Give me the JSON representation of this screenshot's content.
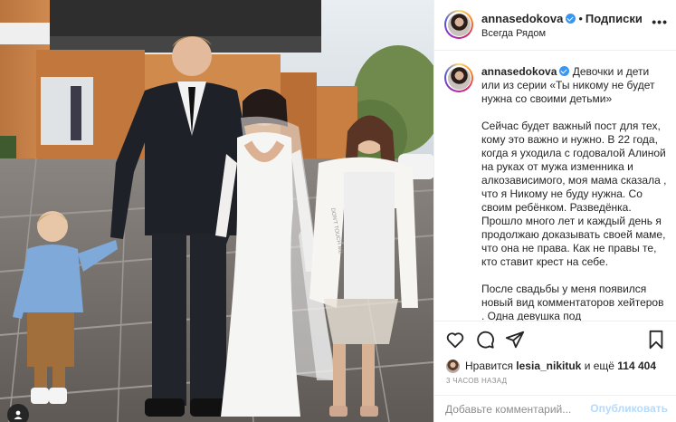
{
  "post": {
    "username": "annasedokova",
    "follow_label": "Подписки",
    "location": "Всегда Рядом"
  },
  "caption": {
    "paragraphs": [
      "Девочки и дети или из серии «Ты никому не будет нужна со своими детьми»",
      "Сейчас будет важный пост для тех, кому это важно и нужно. В 22 года, когда я уходила с годовалой Алиной на руках от мужа изменника и алкозависимого, моя мама сказала , что я Никому не буду нужна. Со своим ребёнком. Разведёнка. Прошло много лет и каждый день я продолжаю доказывать своей маме, что она не права. Как не правы те, кто ставит крест на себе.",
      "После свадьбы у меня появился новый вид комментаторов хейтеров . Одна девушка под"
    ]
  },
  "likes": {
    "prefix": "Нравится",
    "user": "lesia_nikituk",
    "connector": "и ещё",
    "count": "114 404"
  },
  "timestamp": "3 часов назад",
  "comment_box": {
    "placeholder": "Добавьте комментарий...",
    "post_label": "Опубликовать"
  },
  "photo": {
    "dress_print": "DON'T TOUCH ME"
  },
  "icons": {
    "header": [
      "verified-icon",
      "more-icon"
    ],
    "actions": [
      "heart-icon",
      "comment-icon",
      "share-icon",
      "save-icon"
    ],
    "photo": [
      "user-tag-icon"
    ]
  },
  "colors": {
    "verified": "#3897f0",
    "post_button_disabled": "#b3dbff",
    "muted_text": "#8e8e8e",
    "divider": "#efefef"
  }
}
